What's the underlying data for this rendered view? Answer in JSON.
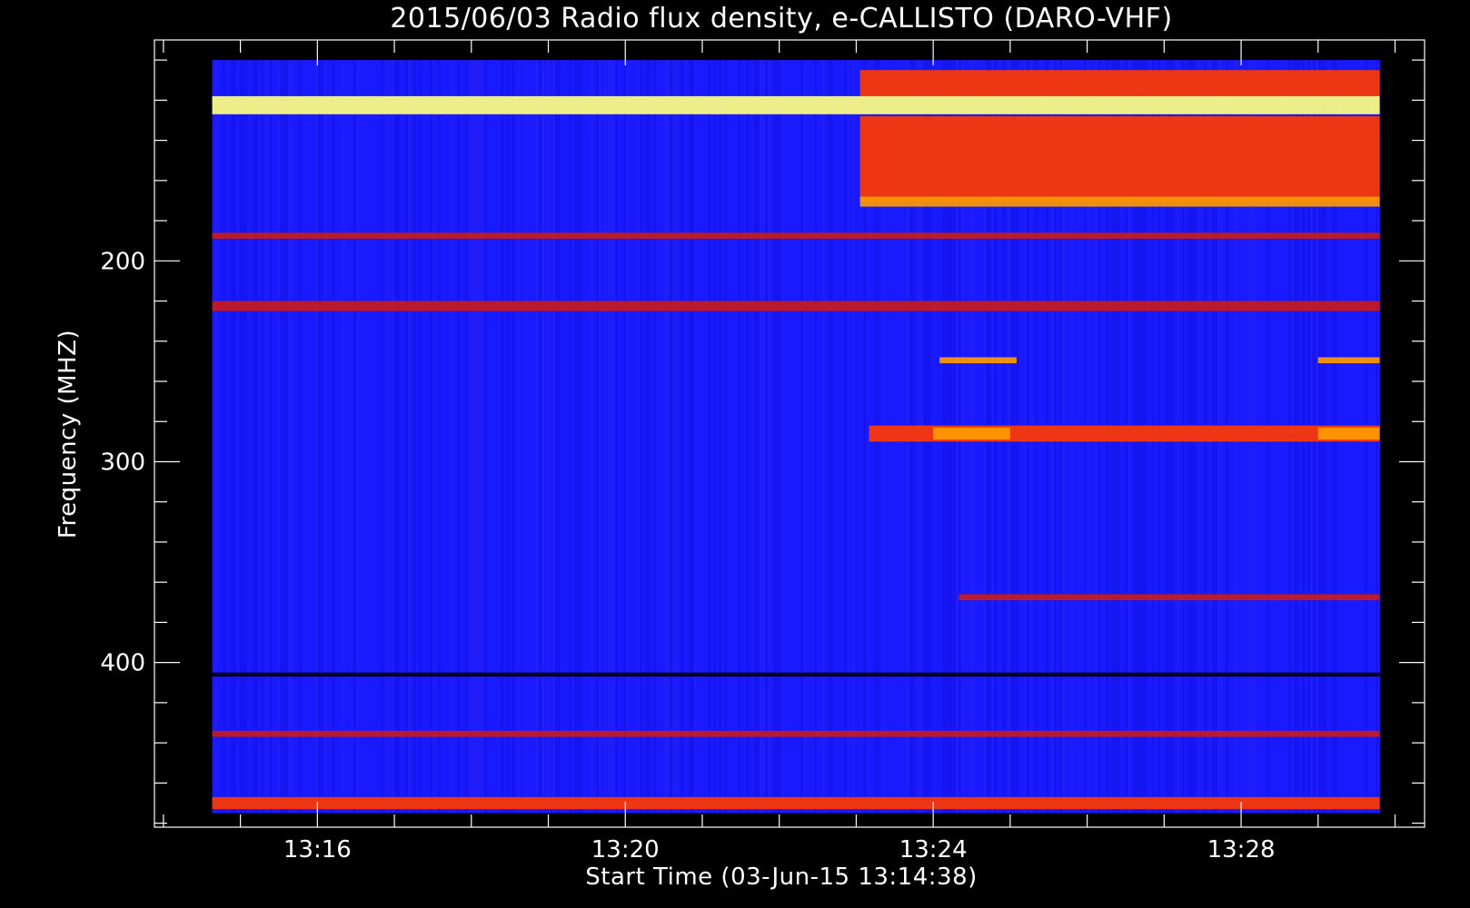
{
  "chart_data": {
    "type": "heatmap",
    "title": "2015/06/03  Radio flux density, e-CALLISTO (DARO-VHF)",
    "xlabel": "Start Time (03-Jun-15 13:14:38)",
    "ylabel": "Frequency (MHZ)",
    "x_axis": {
      "units": "UT time",
      "range": [
        "13:14:38",
        "13:29:48"
      ],
      "plot_range": [
        "13:13:53",
        "13:30:23"
      ],
      "major_ticks": [
        "13:16",
        "13:20",
        "13:24",
        "13:28"
      ],
      "minor_tick_interval_minutes": 1
    },
    "y_axis": {
      "units": "MHz",
      "range": [
        100,
        475
      ],
      "plot_range": [
        90,
        482
      ],
      "reversed": true,
      "major_ticks": [
        200,
        300,
        400
      ],
      "minor_tick_interval": 20
    },
    "colormap": [
      "#000000",
      "#1a1aff",
      "#c81a1a",
      "#ff3a00",
      "#ff9a00",
      "#ffff80"
    ],
    "background_level": 1,
    "features": [
      {
        "name": "continuum burst",
        "t_start": "13:23:03",
        "t_end": "13:29:48",
        "f_low": 128,
        "f_high": 170,
        "level": 3
      },
      {
        "name": "continuum upper band",
        "t_start": "13:23:03",
        "t_end": "13:29:48",
        "f_low": 105,
        "f_high": 118,
        "level": 3
      },
      {
        "name": "strip 172 MHz",
        "t_start": "13:23:03",
        "t_end": "13:29:48",
        "f_low": 168,
        "f_high": 173,
        "level": 4
      },
      {
        "name": "interference 120-125 MHz",
        "t_start": "13:14:38",
        "t_end": "13:29:48",
        "f_low": 118,
        "f_high": 127,
        "level": 5
      },
      {
        "name": "line 188 MHz",
        "t_start": "13:14:38",
        "t_end": "13:29:48",
        "f_low": 186,
        "f_high": 189,
        "level": 2
      },
      {
        "name": "line 222 MHz",
        "t_start": "13:14:38",
        "t_end": "13:29:48",
        "f_low": 220,
        "f_high": 225,
        "level": 2
      },
      {
        "name": "band 250 MHz",
        "t_start": "13:24:05",
        "t_end": "13:25:05",
        "f_low": 248,
        "f_high": 251,
        "level": 4
      },
      {
        "name": "band 250 MHz late",
        "t_start": "13:29:00",
        "t_end": "13:29:48",
        "f_low": 248,
        "f_high": 251,
        "level": 4
      },
      {
        "name": "band 286 MHz",
        "t_start": "13:23:10",
        "t_end": "13:29:48",
        "f_low": 282,
        "f_high": 290,
        "level": 3
      },
      {
        "name": "band 286 MHz bright",
        "t_start": "13:24:00",
        "t_end": "13:25:00",
        "f_low": 283,
        "f_high": 289,
        "level": 4
      },
      {
        "name": "band 286 MHz bright late",
        "t_start": "13:29:00",
        "t_end": "13:29:48",
        "f_low": 283,
        "f_high": 289,
        "level": 4
      },
      {
        "name": "line 368 MHz",
        "t_start": "13:24:20",
        "t_end": "13:29:48",
        "f_low": 366,
        "f_high": 369,
        "level": 2
      },
      {
        "name": "line 406 MHz",
        "t_start": "13:14:38",
        "t_end": "13:29:48",
        "f_low": 405,
        "f_high": 407,
        "level": 0
      },
      {
        "name": "line 436 MHz",
        "t_start": "13:14:38",
        "t_end": "13:29:48",
        "f_low": 434,
        "f_high": 437,
        "level": 2
      },
      {
        "name": "interference 470 MHz",
        "t_start": "13:14:38",
        "t_end": "13:29:48",
        "f_low": 467,
        "f_high": 473,
        "level": 3
      }
    ],
    "grid": false,
    "legend": "none"
  }
}
